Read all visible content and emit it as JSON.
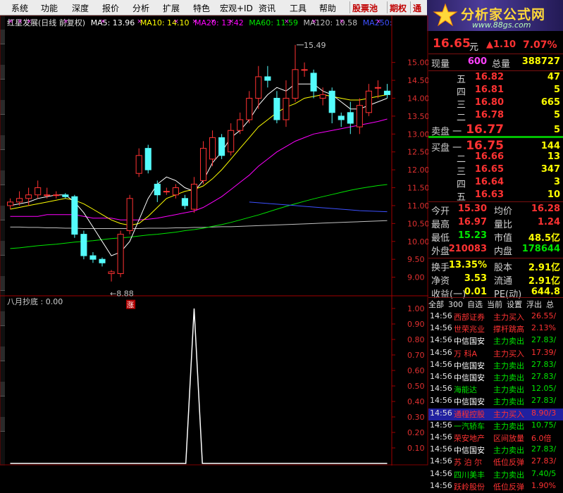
{
  "menu": {
    "items": [
      "系统",
      "功能",
      "深度",
      "报价",
      "分析",
      "扩展",
      "特色",
      "宏观+ID",
      "资讯",
      "工具",
      "帮助"
    ],
    "highlight": [
      "股票池",
      "期权",
      "通"
    ]
  },
  "logo": {
    "title": "分析家公式网",
    "url": "www.88gs.com"
  },
  "chart_title": {
    "name": "红星发展(日线 前复权)",
    "ma5": "MA5: 13.96",
    "ma10": "MA10: 14.10",
    "ma20": "MA20: 13.42",
    "ma60": "MA60: 11.59",
    "ma120": "MA120: 10.58",
    "ma250": "MA250:"
  },
  "colors": {
    "up": "#ff3232",
    "down": "#54fcfc",
    "ma5": "#ffffff",
    "ma10": "#ffff00",
    "ma20": "#ff00ff",
    "ma60": "#00e600",
    "ma120": "#c0c0c0",
    "ma250": "#3c50ff"
  },
  "annotations": {
    "high": "15.49",
    "low": "8.88",
    "zhang": "涨"
  },
  "y_axis": [
    "15.00",
    "14.50",
    "14.00",
    "13.50",
    "13.00",
    "12.50",
    "12.00",
    "11.50",
    "11.00",
    "10.50",
    "10.00",
    "9.50",
    "9.00"
  ],
  "sub_indicator": {
    "title": "八月抄底 : 0.00",
    "ticks": [
      "1.00",
      "0.90",
      "0.80",
      "0.70",
      "0.60",
      "0.50",
      "0.40",
      "0.30",
      "0.20",
      "0.10"
    ]
  },
  "chart_data": {
    "type": "candlestick",
    "ylim": [
      8.5,
      15.8
    ],
    "candles": [
      {
        "o": 11.0,
        "c": 11.1,
        "h": 11.2,
        "l": 10.9
      },
      {
        "o": 11.1,
        "c": 11.2,
        "h": 11.4,
        "l": 11.0
      },
      {
        "o": 11.2,
        "c": 11.3,
        "h": 11.5,
        "l": 11.0
      },
      {
        "o": 11.3,
        "c": 11.5,
        "h": 11.7,
        "l": 11.2
      },
      {
        "o": 11.3,
        "c": 11.3,
        "h": 11.5,
        "l": 11.2
      },
      {
        "o": 11.3,
        "c": 11.3,
        "h": 11.4,
        "l": 11.2
      },
      {
        "o": 11.3,
        "c": 11.25,
        "h": 11.35,
        "l": 11.2
      },
      {
        "o": 11.25,
        "c": 10.2,
        "h": 11.3,
        "l": 10.1
      },
      {
        "o": 10.2,
        "c": 9.6,
        "h": 10.3,
        "l": 9.5
      },
      {
        "o": 9.6,
        "c": 9.5,
        "h": 9.7,
        "l": 9.4
      },
      {
        "o": 9.5,
        "c": 9.4,
        "h": 9.55,
        "l": 9.3
      },
      {
        "o": 9.1,
        "c": 9.15,
        "h": 9.2,
        "l": 8.88
      },
      {
        "o": 9.1,
        "c": 10.2,
        "h": 10.3,
        "l": 9.0
      },
      {
        "o": 10.3,
        "c": 11.2,
        "h": 11.3,
        "l": 10.2
      },
      {
        "o": 11.9,
        "c": 12.4,
        "h": 12.6,
        "l": 11.8
      },
      {
        "o": 12.6,
        "c": 12.0,
        "h": 12.7,
        "l": 11.9
      },
      {
        "o": 11.6,
        "c": 11.3,
        "h": 11.7,
        "l": 11.1
      },
      {
        "o": 11.4,
        "c": 11.4,
        "h": 11.5,
        "l": 11.3
      },
      {
        "o": 11.3,
        "c": 11.5,
        "h": 11.6,
        "l": 11.2
      },
      {
        "o": 11.2,
        "c": 11.0,
        "h": 11.3,
        "l": 10.9
      },
      {
        "o": 10.9,
        "c": 11.6,
        "h": 11.8,
        "l": 10.8
      },
      {
        "o": 11.7,
        "c": 12.6,
        "h": 12.8,
        "l": 11.6
      },
      {
        "o": 12.3,
        "c": 12.9,
        "h": 13.1,
        "l": 12.1
      },
      {
        "o": 12.9,
        "c": 12.4,
        "h": 13.0,
        "l": 12.3
      },
      {
        "o": 12.5,
        "c": 13.1,
        "h": 13.3,
        "l": 12.4
      },
      {
        "o": 13.1,
        "c": 13.4,
        "h": 13.6,
        "l": 13.0
      },
      {
        "o": 13.4,
        "c": 14.0,
        "h": 14.2,
        "l": 13.3
      },
      {
        "o": 14.0,
        "c": 14.6,
        "h": 14.9,
        "l": 13.7
      },
      {
        "o": 14.6,
        "c": 14.5,
        "h": 14.9,
        "l": 14.3
      },
      {
        "o": 14.0,
        "c": 13.4,
        "h": 14.2,
        "l": 13.3
      },
      {
        "o": 13.4,
        "c": 14.0,
        "h": 14.5,
        "l": 13.2
      },
      {
        "o": 14.0,
        "c": 14.8,
        "h": 15.49,
        "l": 13.9
      },
      {
        "o": 14.8,
        "c": 14.8,
        "h": 15.0,
        "l": 14.6
      },
      {
        "o": 14.7,
        "c": 14.2,
        "h": 14.8,
        "l": 14.0
      },
      {
        "o": 14.0,
        "c": 14.1,
        "h": 14.3,
        "l": 13.8
      },
      {
        "o": 14.2,
        "c": 13.6,
        "h": 14.3,
        "l": 13.3
      },
      {
        "o": 13.5,
        "c": 13.4,
        "h": 13.6,
        "l": 13.2
      },
      {
        "o": 13.6,
        "c": 13.3,
        "h": 13.9,
        "l": 13.0
      },
      {
        "o": 13.2,
        "c": 13.8,
        "h": 14.0,
        "l": 13.0
      },
      {
        "o": 13.6,
        "c": 14.2,
        "h": 14.4,
        "l": 13.5
      },
      {
        "o": 14.3,
        "c": 14.3,
        "h": 14.5,
        "l": 14.0
      },
      {
        "o": 14.2,
        "c": 14.1,
        "h": 14.4,
        "l": 14.0
      }
    ],
    "ma5": [
      11.0,
      11.05,
      11.1,
      11.2,
      11.25,
      11.3,
      11.3,
      11.1,
      10.8,
      10.4,
      10.0,
      9.6,
      9.7,
      10.0,
      10.6,
      11.2,
      11.6,
      11.8,
      11.7,
      11.5,
      11.4,
      11.7,
      12.2,
      12.5,
      12.9,
      13.1,
      13.4,
      13.8,
      14.1,
      14.3,
      14.2,
      14.4,
      14.4,
      14.4,
      14.2,
      14.1,
      13.9,
      13.7,
      13.7,
      13.8,
      13.9,
      14.0
    ],
    "ma10": [
      10.9,
      10.95,
      11.0,
      11.05,
      11.1,
      11.15,
      11.2,
      11.15,
      11.05,
      10.9,
      10.75,
      10.6,
      10.5,
      10.45,
      10.5,
      10.7,
      10.95,
      11.2,
      11.3,
      11.4,
      11.45,
      11.55,
      11.75,
      12.0,
      12.3,
      12.6,
      12.9,
      13.2,
      13.4,
      13.6,
      13.75,
      13.85,
      14.0,
      14.05,
      14.1,
      14.05,
      14.0,
      13.95,
      13.95,
      14.0,
      14.05,
      14.1
    ],
    "ma20": [
      10.7,
      10.7,
      10.7,
      10.7,
      10.75,
      10.75,
      10.75,
      10.75,
      10.7,
      10.65,
      10.65,
      10.65,
      10.6,
      10.6,
      10.6,
      10.62,
      10.65,
      10.7,
      10.75,
      10.8,
      10.85,
      10.95,
      11.1,
      11.25,
      11.45,
      11.65,
      11.85,
      12.1,
      12.3,
      12.5,
      12.65,
      12.8,
      12.9,
      13.0,
      13.05,
      13.1,
      13.15,
      13.2,
      13.25,
      13.3,
      13.35,
      13.42
    ],
    "ma60": [
      9.8,
      9.82,
      9.85,
      9.88,
      9.9,
      9.92,
      9.95,
      9.98,
      10.0,
      10.02,
      10.05,
      10.08,
      10.1,
      10.12,
      10.15,
      10.18,
      10.2,
      10.23,
      10.26,
      10.3,
      10.33,
      10.37,
      10.42,
      10.47,
      10.53,
      10.6,
      10.67,
      10.74,
      10.82,
      10.9,
      10.98,
      11.05,
      11.12,
      11.19,
      11.25,
      11.31,
      11.37,
      11.43,
      11.48,
      11.52,
      11.56,
      11.59
    ],
    "ma120": [
      10.4,
      10.4,
      10.39,
      10.39,
      10.38,
      10.38,
      10.37,
      10.37,
      10.36,
      10.36,
      10.36,
      10.36,
      10.36,
      10.36,
      10.36,
      10.37,
      10.37,
      10.37,
      10.38,
      10.38,
      10.39,
      10.39,
      10.4,
      10.41,
      10.41,
      10.42,
      10.43,
      10.44,
      10.45,
      10.46,
      10.47,
      10.48,
      10.49,
      10.5,
      10.51,
      10.52,
      10.53,
      10.54,
      10.55,
      10.56,
      10.57,
      10.58
    ],
    "ma250_start": 26,
    "ma250": [
      11.1,
      11.08,
      11.06,
      11.04,
      11.02,
      11.0,
      10.98,
      10.96,
      10.94,
      10.92,
      10.9,
      10.88,
      10.86,
      10.85,
      10.84,
      10.83
    ],
    "sub_values": [
      0,
      0,
      0,
      0,
      0,
      0,
      0,
      0,
      0,
      0,
      0,
      0,
      0,
      0,
      0,
      0,
      0,
      0,
      0,
      0,
      1,
      0,
      0,
      0,
      0,
      0,
      0,
      0,
      0,
      0,
      0,
      0,
      0,
      0,
      0,
      0,
      0,
      0,
      0,
      0,
      0,
      0
    ]
  },
  "quote": {
    "price": "16.65",
    "unit": "元",
    "change": "1.10",
    "pct": "7.07%",
    "xianliang_label": "现量",
    "xianliang": "600",
    "zongliang_label": "总量",
    "zongliang": "388727",
    "sell": [
      {
        "label": "五",
        "price": "16.82",
        "vol": "47"
      },
      {
        "label": "四",
        "price": "16.81",
        "vol": "5"
      },
      {
        "label": "三",
        "price": "16.80",
        "vol": "665"
      },
      {
        "label": "二",
        "price": "16.78",
        "vol": "5"
      },
      {
        "label": "卖盘 一",
        "price": "16.77",
        "vol": "5"
      }
    ],
    "buy": [
      {
        "label": "买盘 一",
        "price": "16.75",
        "vol": "144"
      },
      {
        "label": "二",
        "price": "16.66",
        "vol": "13"
      },
      {
        "label": "三",
        "price": "16.65",
        "vol": "347"
      },
      {
        "label": "四",
        "price": "16.64",
        "vol": "3"
      },
      {
        "label": "五",
        "price": "16.63",
        "vol": "10"
      }
    ],
    "stats": [
      [
        "今开",
        "15.30",
        "均价",
        "16.28"
      ],
      [
        "最高",
        "16.97",
        "量比",
        "1.24"
      ],
      [
        "最低",
        "15.23",
        "市值",
        "48.5亿"
      ],
      [
        "外盘",
        "210083",
        "内盘",
        "178644"
      ],
      [
        "换手",
        "13.35%",
        "股本",
        "2.91亿"
      ],
      [
        "净资",
        "3.53",
        "流通",
        "2.91亿"
      ],
      [
        "收益(一)",
        "0.01",
        "PE(动)",
        "644.8"
      ]
    ]
  },
  "tick_tabs": [
    "全部",
    "300",
    "自选",
    "当前",
    "设置",
    "浮出",
    "总"
  ],
  "ticks": [
    {
      "t": "14:56",
      "name": "西部证券",
      "sig": "主力买入",
      "v": "26.55/",
      "c": "#ff3232"
    },
    {
      "t": "14:56",
      "name": "世荣兆业",
      "sig": "撑杆跳高",
      "v": "2.13%",
      "c": "#ff3232"
    },
    {
      "t": "14:56",
      "name": "中信国安",
      "sig": "主力卖出",
      "v": "27.83/",
      "c": "#ffffff"
    },
    {
      "t": "14:56",
      "name": "万  科A",
      "sig": "主力买入",
      "v": "17.39/",
      "c": "#ff3232"
    },
    {
      "t": "14:56",
      "name": "中信国安",
      "sig": "主力卖出",
      "v": "27.83/",
      "c": "#ffffff"
    },
    {
      "t": "14:56",
      "name": "中信国安",
      "sig": "主力卖出",
      "v": "27.83/",
      "c": "#ffffff"
    },
    {
      "t": "14:56",
      "name": "海能达",
      "sig": "主力卖出",
      "v": "12.05/",
      "c": "#00e600"
    },
    {
      "t": "14:56",
      "name": "中信国安",
      "sig": "主力卖出",
      "v": "27.83/",
      "c": "#ffffff"
    },
    {
      "t": "14:56",
      "name": "通程控股",
      "sig": "主力买入",
      "v": "8.90/3",
      "c": "#ff3232",
      "hl": true
    },
    {
      "t": "14:56",
      "name": "一汽轿车",
      "sig": "主力卖出",
      "v": "10.75/",
      "c": "#00e600"
    },
    {
      "t": "14:56",
      "name": "荣安地产",
      "sig": "区间放量",
      "v": "6.0倍",
      "c": "#ff3232"
    },
    {
      "t": "14:56",
      "name": "中信国安",
      "sig": "主力卖出",
      "v": "27.83/",
      "c": "#ffffff"
    },
    {
      "t": "14:56",
      "name": "苏 泊 尔",
      "sig": "低位反弹",
      "v": "27.83/",
      "c": "#ff3232"
    },
    {
      "t": "14:56",
      "name": "四川美丰",
      "sig": "主力卖出",
      "v": "7.40/5",
      "c": "#00e600"
    },
    {
      "t": "14:56",
      "name": "跃岭股份",
      "sig": "低位反弹",
      "v": "1.90%",
      "c": "#ff3232"
    }
  ]
}
